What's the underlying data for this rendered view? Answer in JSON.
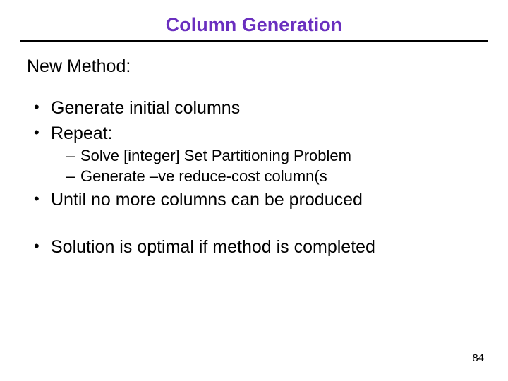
{
  "title": "Column Generation",
  "subtitle": "New Method:",
  "bullets": {
    "b1": "Generate initial columns",
    "b2": "Repeat:",
    "b2_sub1": "Solve [integer] Set Partitioning Problem",
    "b2_sub2": "Generate –ve reduce-cost column(s",
    "b3": "Until no more columns can be produced",
    "b4": "Solution is optimal if method is completed"
  },
  "page_number": "84"
}
